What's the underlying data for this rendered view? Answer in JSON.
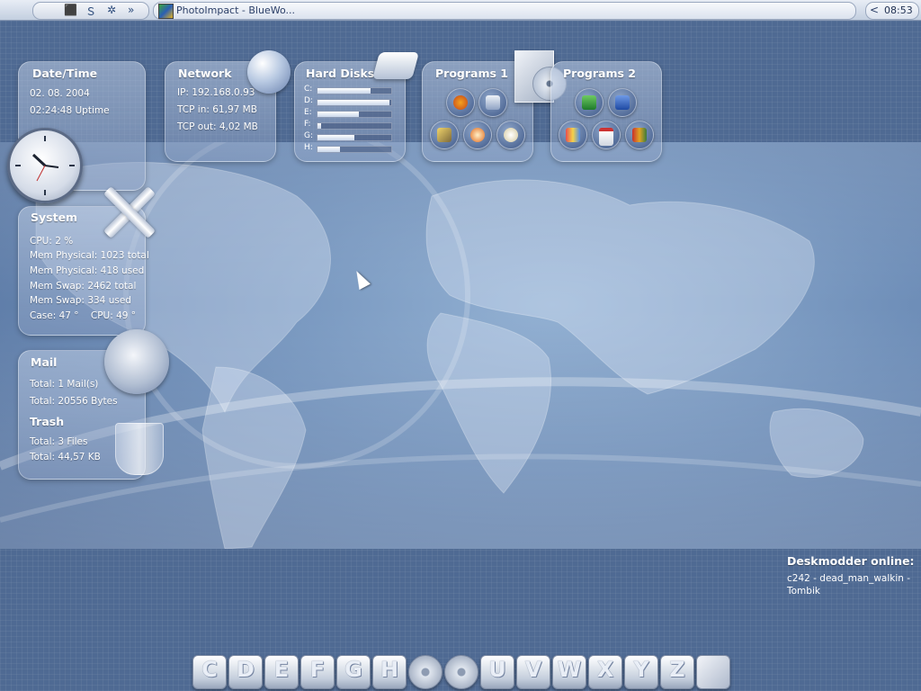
{
  "taskbar": {
    "quicklaunch": [
      "desktop-icon",
      "s-icon",
      "gear-icon"
    ],
    "more": "»",
    "task_label": "PhotoImpact - BlueWo...",
    "clock": "08:53",
    "tray_chevron": "<"
  },
  "datetime": {
    "title": "Date/Time",
    "date": "02. 08. 2004",
    "uptime": "02:24:48 Uptime"
  },
  "network": {
    "title": "Network",
    "ip": "IP: 192.168.0.93",
    "tcp_in": "TCP in: 61,97 MB",
    "tcp_out": "TCP out: 4,02 MB"
  },
  "hard_disks": {
    "title": "Hard Disks",
    "drives": [
      {
        "label": "C:",
        "usage": 0.72
      },
      {
        "label": "D:",
        "usage": 0.98
      },
      {
        "label": "E:",
        "usage": 0.56
      },
      {
        "label": "F:",
        "usage": 0.05
      },
      {
        "label": "G:",
        "usage": 0.5
      },
      {
        "label": "H:",
        "usage": 0.3
      }
    ]
  },
  "programs1": {
    "title": "Programs 1",
    "items": [
      "firefox-icon",
      "calculator-icon",
      "tools-icon",
      "burn-icon",
      "sheep-icon"
    ]
  },
  "programs2": {
    "title": "Programs 2",
    "items": [
      "excel-icon",
      "word-icon",
      "paint-icon",
      "calendar-icon",
      "books-icon"
    ]
  },
  "system": {
    "title": "System",
    "cpu": "CPU: 2 %",
    "mem_phys_total": "Mem Physical: 1023 total",
    "mem_phys_used": "Mem Physical: 418 used",
    "mem_swap_total": "Mem Swap: 2462 total",
    "mem_swap_used": "Mem Swap: 334 used",
    "temps": "Case: 47 °    CPU: 49 °"
  },
  "mail": {
    "title": "Mail",
    "total_mails": "Total: 1 Mail(s)",
    "total_bytes": "Total: 20556 Bytes"
  },
  "trash": {
    "title": "Trash",
    "total_files": "Total: 3 Files",
    "total_size": "Total: 44,57 KB"
  },
  "deskmodder": {
    "title": "Deskmodder online:",
    "users": "c242 - dead_man_walkin - Tombik"
  },
  "dock": {
    "drives": [
      "C",
      "D",
      "E",
      "F",
      "G",
      "H",
      "",
      "",
      "U",
      "V",
      "W",
      "X",
      "Y",
      "Z"
    ]
  },
  "colors": {
    "background": "#4f6a93",
    "panel_text": "#ffffff"
  }
}
